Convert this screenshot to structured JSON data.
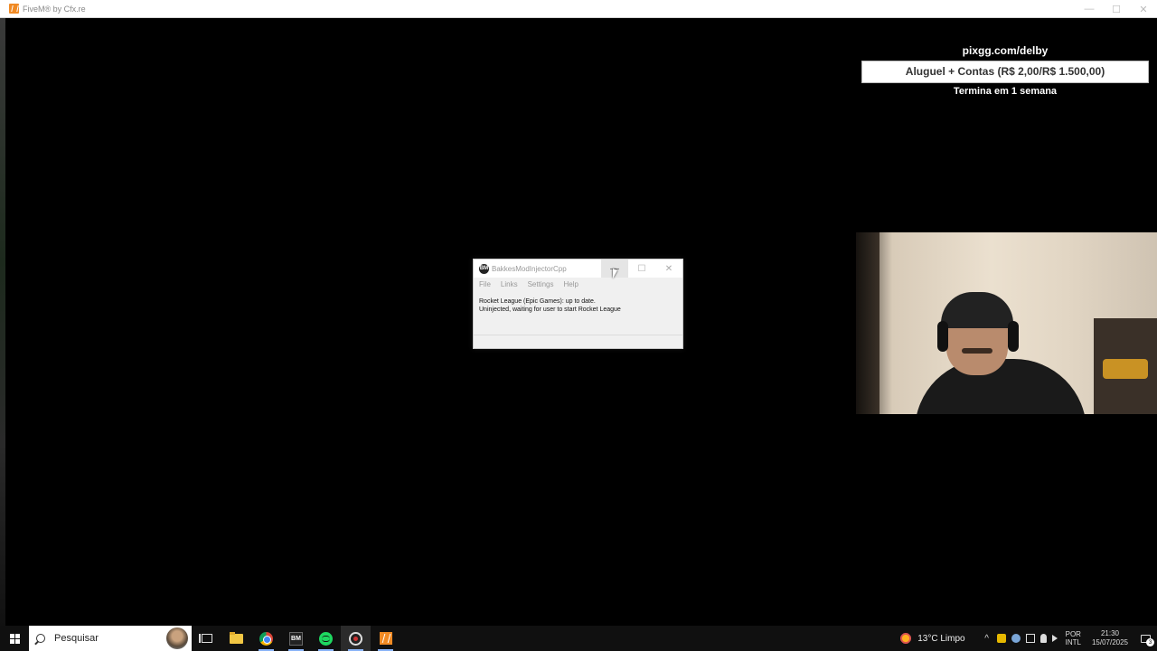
{
  "fivem_window": {
    "title": "FiveM® by Cfx.re",
    "minimize": "—",
    "maximize": "☐",
    "close": "✕"
  },
  "overlay": {
    "url": "pixgg.com/delby",
    "goal": "Aluguel + Contas (R$ 2,00/R$ 1.500,00)",
    "goal_progress_fraction": 0.0013,
    "ends": "Termina em 1 semana"
  },
  "bakkes": {
    "icon_text": "BM",
    "title": "BakkesModInjectorCpp",
    "controls": {
      "minimize": "—",
      "maximize": "☐",
      "close": "✕"
    },
    "menu": [
      "File",
      "Links",
      "Settings",
      "Help"
    ],
    "status_line1": "Rocket League (Epic Games): up to date.",
    "status_line2": "Uninjected, waiting for user to start Rocket League"
  },
  "taskbar": {
    "search_placeholder": "Pesquisar",
    "apps": [
      "task-view",
      "file-explorer",
      "chrome",
      "bakkesmod",
      "spotify",
      "obs",
      "fivem"
    ],
    "bm_icon_text": "BM"
  },
  "tray": {
    "weather": "13°C  Limpo",
    "chevron": "^",
    "language_line1": "POR",
    "language_line2": "INTL",
    "time": "21:30",
    "date": "15/07/2025",
    "notifications": "3"
  }
}
